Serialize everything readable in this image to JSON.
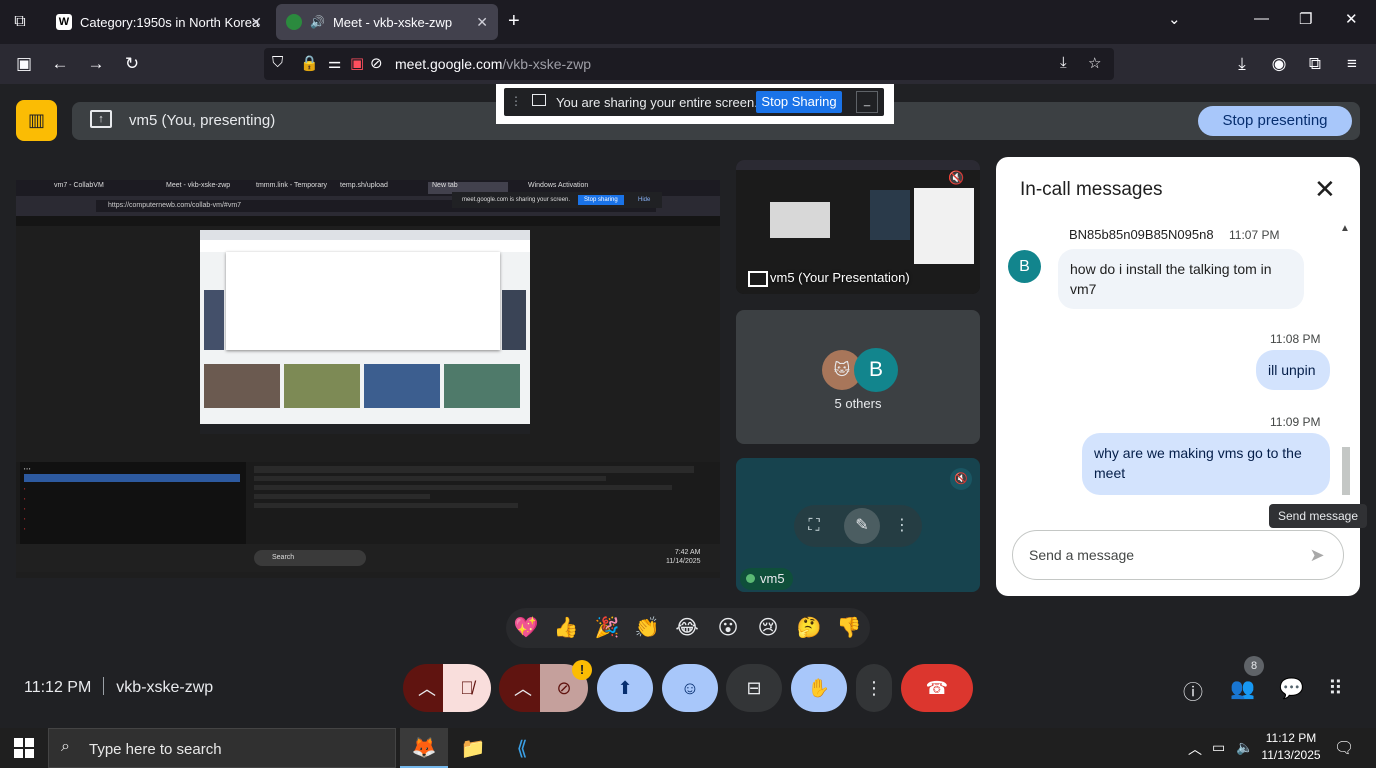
{
  "browser": {
    "tabs": [
      {
        "title": "Category:1950s in North Korea",
        "favicon": "W"
      },
      {
        "title": "Meet - vkb-xske-zwp",
        "favicon": "meet"
      }
    ],
    "url_host": "meet.google.com",
    "url_path": "/vkb-xske-zwp"
  },
  "share_banner": {
    "text": "You are sharing your entire screen.",
    "stop_label": "Stop Sharing",
    "hide_label": "_"
  },
  "presenting": {
    "label": "vm5 (You, presenting)",
    "stop_label": "Stop presenting"
  },
  "shared_screen": {
    "tabs": [
      "vm7 - CollabVM",
      "Meet - vkb-xske-zwp",
      "tmmm.link - Temporary",
      "temp.sh/upload",
      "New tab",
      "Windows Activation"
    ],
    "url": "https://computernewb.com/collab-vm/#vm7",
    "share_notice": "meet.google.com is sharing your screen.",
    "stop_sharing": "Stop sharing",
    "hide": "Hide",
    "taskbar_search": "Search",
    "time": "7:42 AM",
    "date": "11/14/2025"
  },
  "tiles": {
    "self_label": "vm5 (Your Presentation)",
    "others_avatar_letter": "B",
    "others_label": "5 others",
    "vm5_label": "vm5"
  },
  "chat": {
    "title": "In-call messages",
    "messages": [
      {
        "sender": "BN85b85n09B85N095n8",
        "time": "11:07 PM",
        "avatar": "B",
        "text": "how do i install the talking tom in vm7"
      },
      {
        "time": "11:08 PM",
        "text": "ill unpin"
      },
      {
        "time": "11:09 PM",
        "text": "why are we making vms go to the meet"
      }
    ],
    "input_placeholder": "Send a message",
    "send_tooltip": "Send message"
  },
  "reactions": [
    "💖",
    "👍",
    "🎉",
    "👏",
    "😂",
    "😮",
    "😢",
    "🤔",
    "👎"
  ],
  "meeting": {
    "time": "11:12 PM",
    "code": "vkb-xske-zwp",
    "people_count": "8",
    "camera_warning": "!"
  },
  "taskbar": {
    "search_placeholder": "Type here to search",
    "time": "11:12 PM",
    "date": "11/13/2025"
  },
  "colors": {
    "meet_bg": "#202124",
    "accent_blue": "#a8c7fa",
    "end_call_red": "#dc362e",
    "presenting_logo": "#fbbc04",
    "avatar_teal": "#12858d"
  }
}
